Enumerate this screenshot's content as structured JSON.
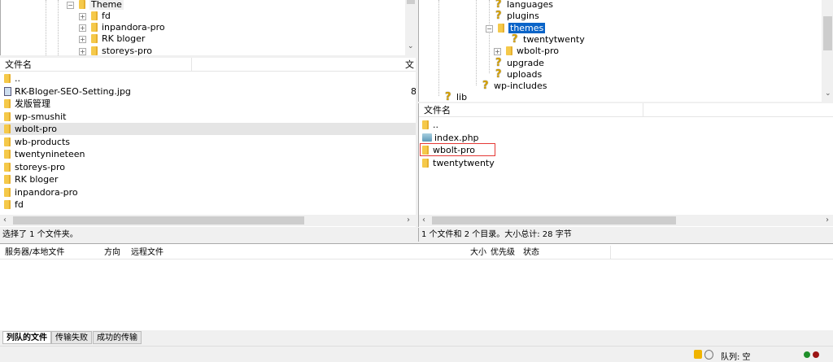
{
  "local_tree": {
    "items": [
      {
        "label": "Theme",
        "expanded": true
      },
      {
        "label": "fd"
      },
      {
        "label": "inpandora-pro"
      },
      {
        "label": "RK bloger"
      },
      {
        "label": "storeys-pro"
      }
    ]
  },
  "local_list": {
    "col_name": "文件名",
    "col_size": "文",
    "rows": [
      {
        "name": "..",
        "type": "folder"
      },
      {
        "name": "RK-Bloger-SEO-Setting.jpg",
        "type": "image",
        "size": "8"
      },
      {
        "name": "发版管理",
        "type": "folder"
      },
      {
        "name": "wp-smushit",
        "type": "folder"
      },
      {
        "name": "wbolt-pro",
        "type": "folder",
        "selected": true
      },
      {
        "name": "wb-products",
        "type": "folder"
      },
      {
        "name": "twentynineteen",
        "type": "folder"
      },
      {
        "name": "storeys-pro",
        "type": "folder"
      },
      {
        "name": "RK bloger",
        "type": "folder"
      },
      {
        "name": "inpandora-pro",
        "type": "folder"
      },
      {
        "name": "fd",
        "type": "folder"
      }
    ],
    "status": "选择了 1 个文件夹。"
  },
  "remote_tree": {
    "items": [
      {
        "label": "languages",
        "icon": "question"
      },
      {
        "label": "plugins",
        "icon": "question"
      },
      {
        "label": "themes",
        "icon": "folder",
        "selected": true
      },
      {
        "label": "twentytwenty",
        "icon": "question"
      },
      {
        "label": "wbolt-pro",
        "icon": "folder"
      },
      {
        "label": "upgrade",
        "icon": "question"
      },
      {
        "label": "uploads",
        "icon": "question"
      },
      {
        "label": "wp-includes",
        "icon": "question"
      },
      {
        "label": "lib",
        "icon": "question"
      }
    ]
  },
  "remote_list": {
    "col_name": "文件名",
    "rows": [
      {
        "name": "..",
        "type": "folder"
      },
      {
        "name": "index.php",
        "type": "php"
      },
      {
        "name": "wbolt-pro",
        "type": "folder",
        "highlighted": true
      },
      {
        "name": "twentytwenty",
        "type": "folder"
      }
    ],
    "status": "1 个文件和 2 个目录。大小总计: 28 字节"
  },
  "queue": {
    "columns": [
      "服务器/本地文件",
      "方向",
      "远程文件",
      "大小",
      "优先级",
      "状态"
    ],
    "tabs": [
      "列队的文件",
      "传输失败",
      "成功的传输"
    ]
  },
  "statusbar": {
    "queue": "队列: 空"
  },
  "colors": {
    "selection": "#0a64c8",
    "highlight_box": "#e53935",
    "selected_row": "#e5e5e5"
  }
}
